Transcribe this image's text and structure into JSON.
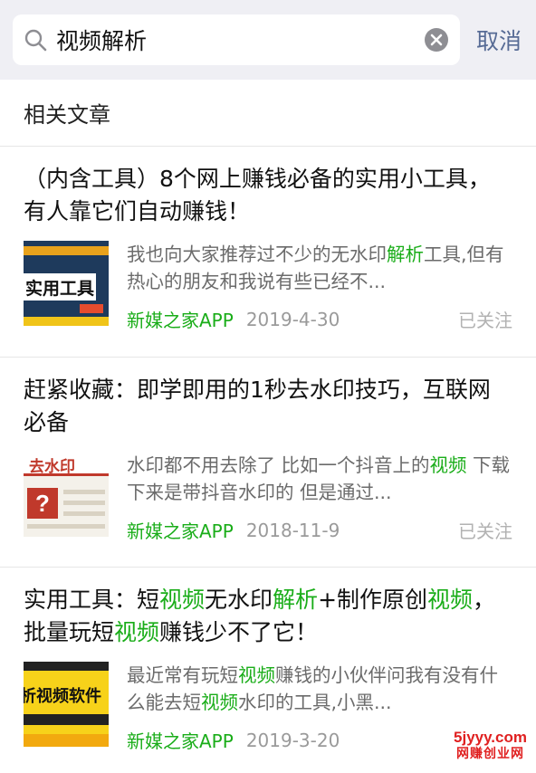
{
  "search": {
    "query": "视频解析",
    "cancel_label": "取消"
  },
  "section": {
    "title": "相关文章"
  },
  "articles": [
    {
      "title": "（内含工具）8个网上赚钱必备的实用小工具，有人靠它们自动赚钱！",
      "snippet_parts": [
        {
          "text": "我也向大家推荐过不少的无水印",
          "hl": false
        },
        {
          "text": "解析",
          "hl": true
        },
        {
          "text": "工具,但有热心的朋友和我说有些已经不...",
          "hl": false
        }
      ],
      "thumb_text": "实用工具",
      "source": "新媒之家APP",
      "date": "2019-4-30",
      "status": "已关注"
    },
    {
      "title": "赶紧收藏：即学即用的1秒去水印技巧，互联网必备",
      "snippet_parts": [
        {
          "text": "水印都不用去除了 比如一个抖音上的",
          "hl": false
        },
        {
          "text": "视频",
          "hl": true
        },
        {
          "text": " 下载下来是带抖音水印的 但是通过...",
          "hl": false
        }
      ],
      "thumb_text": "去水印",
      "source": "新媒之家APP",
      "date": "2018-11-9",
      "status": "已关注"
    },
    {
      "title_parts": [
        {
          "text": "实用工具：短",
          "hl": false
        },
        {
          "text": "视频",
          "hl": true
        },
        {
          "text": "无水印",
          "hl": false
        },
        {
          "text": "解析",
          "hl": true
        },
        {
          "text": "+制作原创",
          "hl": false
        },
        {
          "text": "视频",
          "hl": true
        },
        {
          "text": "，批量玩短",
          "hl": false
        },
        {
          "text": "视频",
          "hl": true
        },
        {
          "text": "赚钱少不了它！",
          "hl": false
        }
      ],
      "snippet_parts": [
        {
          "text": "最近常有玩短",
          "hl": false
        },
        {
          "text": "视频",
          "hl": true
        },
        {
          "text": "赚钱的小伙伴问我有没有什么能去短",
          "hl": false
        },
        {
          "text": "视频",
          "hl": true
        },
        {
          "text": "水印的工具,小黑...",
          "hl": false
        }
      ],
      "thumb_text": "析视频软件",
      "source": "新媒之家APP",
      "date": "2019-3-20",
      "status": ""
    }
  ],
  "watermark": {
    "site": "5jyyy.com",
    "name": "网赚创业网"
  },
  "colors": {
    "highlight": "#1aad19",
    "cancel_link": "#576b95",
    "background_bar": "#efeff4"
  }
}
